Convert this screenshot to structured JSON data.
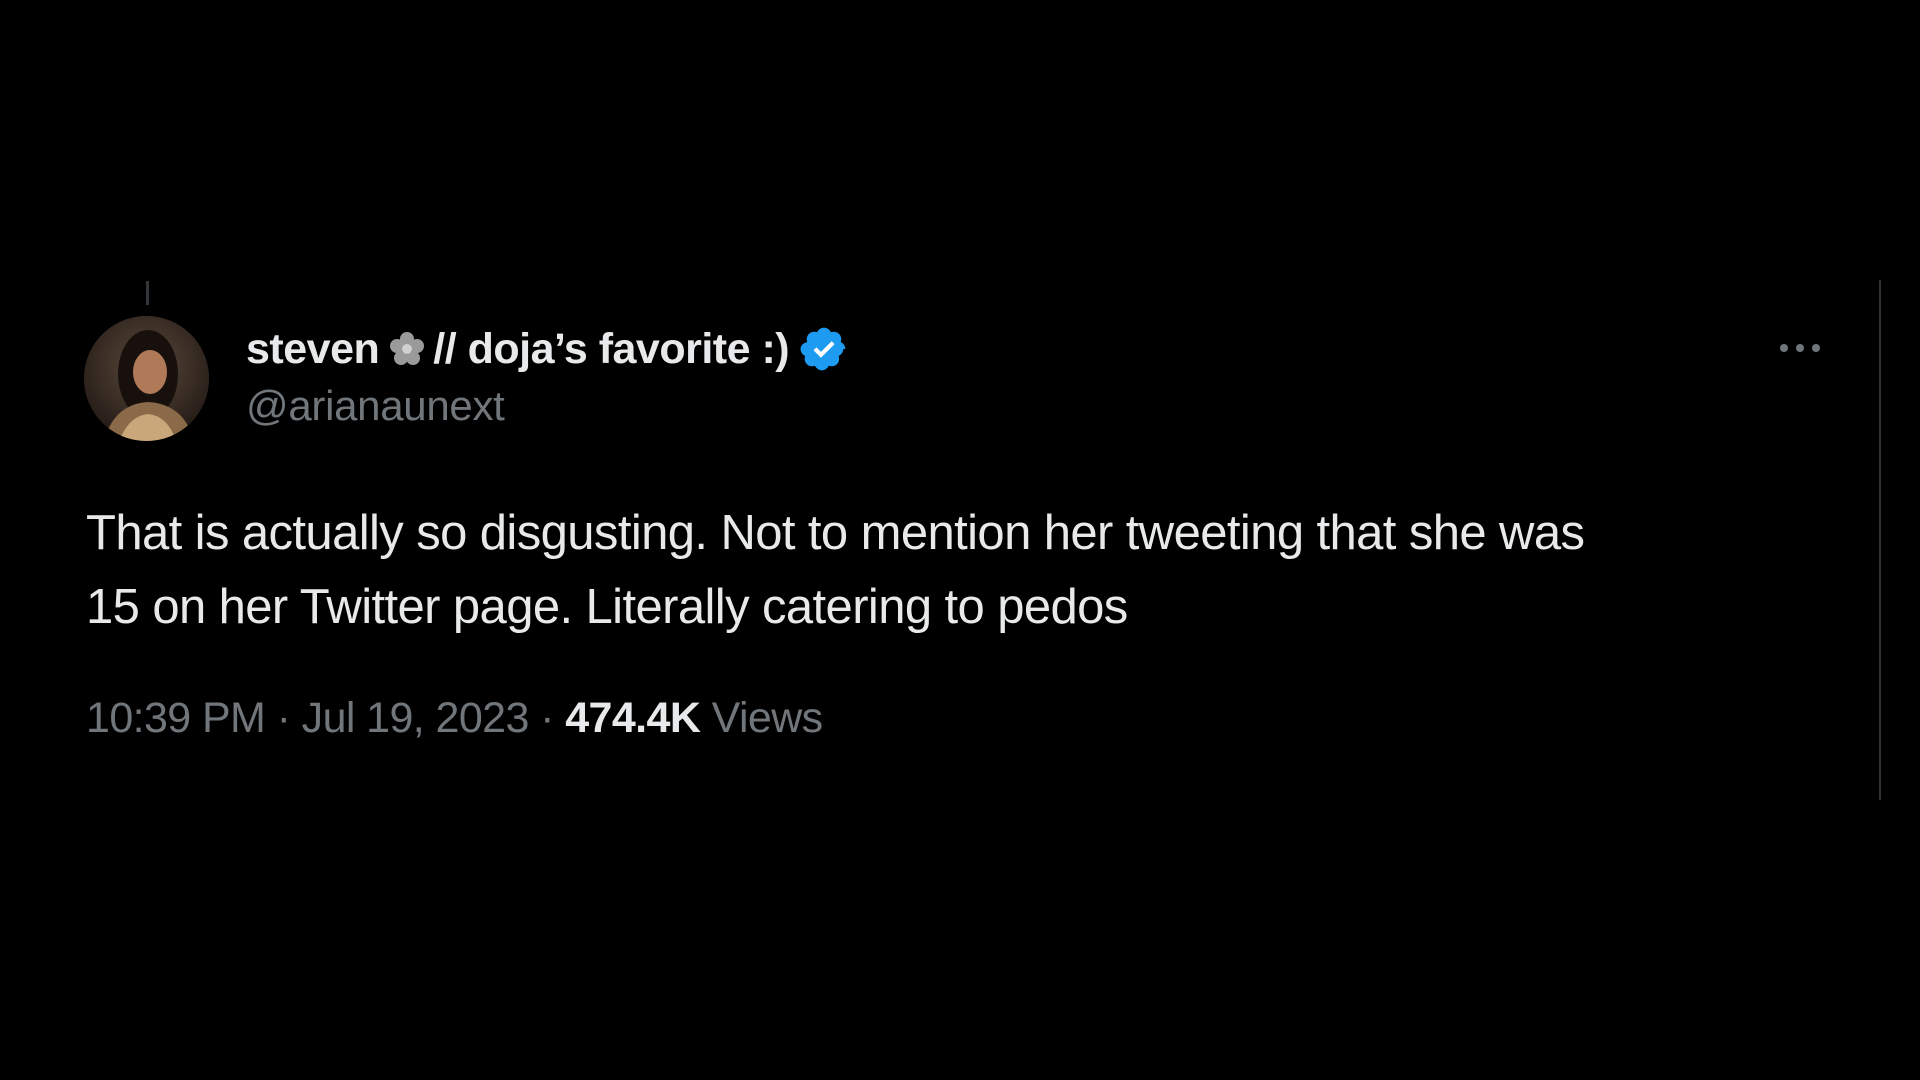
{
  "tweet": {
    "author": {
      "display_name_part1": "steven",
      "display_name_part2": "// doja’s favorite :)",
      "handle": "@arianaunext",
      "verified_icon": "verified-badge-icon",
      "emoji_icon": "flower-icon"
    },
    "text_line1": "That is actually so disgusting. Not to mention her tweeting that she was",
    "text_line2": "15 on her Twitter page. Literally catering to pedos...",
    "timestamp": "10:39 PM · Jul 19, 2023",
    "separator": "·",
    "views_count": "474.4K",
    "views_label": "Views",
    "more_icon": "more-options-icon"
  },
  "colors": {
    "background": "#000000",
    "text_primary": "#e7e9ea",
    "text_secondary": "#71767b",
    "verified_blue": "#1d9bf0"
  }
}
